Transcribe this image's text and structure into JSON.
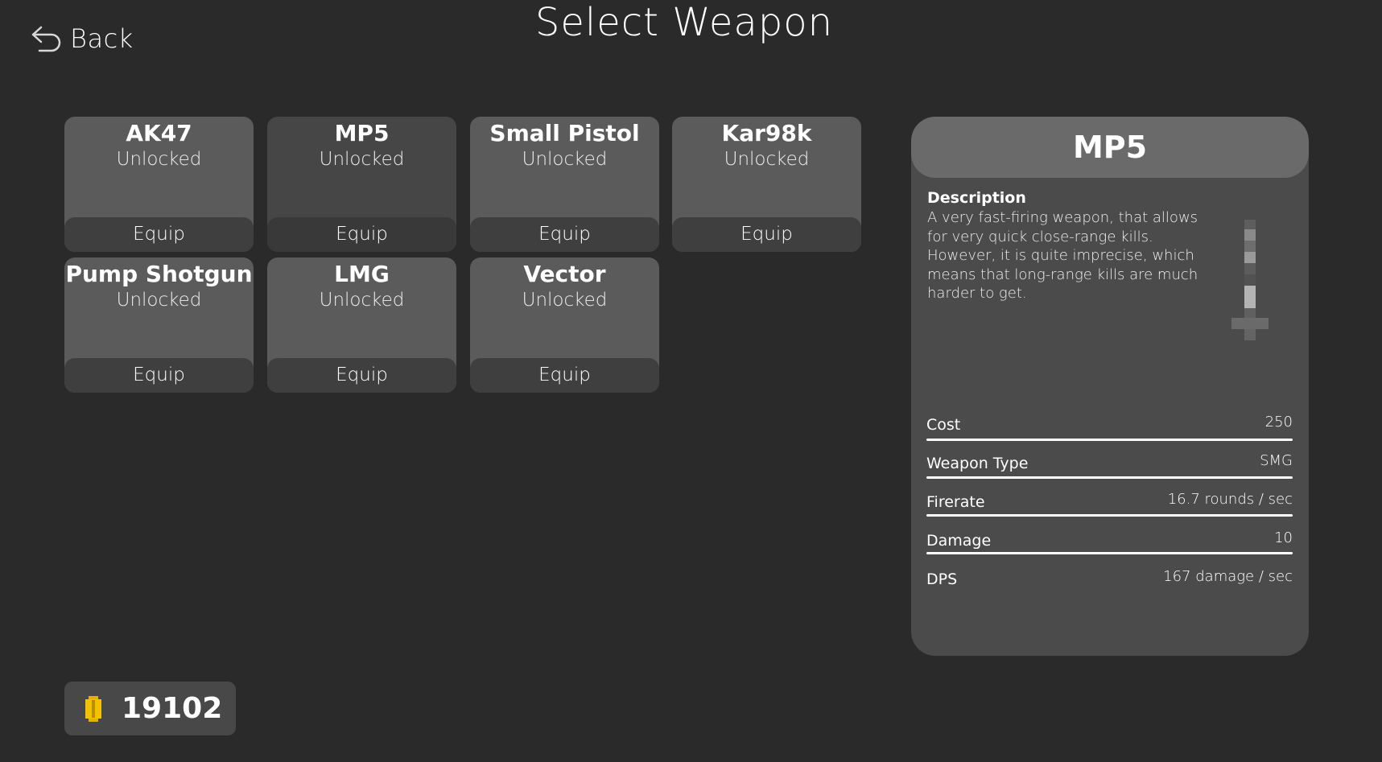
{
  "header": {
    "back_label": "Back",
    "title": "Select Weapon"
  },
  "weapons": [
    {
      "name": "AK47",
      "status": "Unlocked",
      "action": "Equip"
    },
    {
      "name": "MP5",
      "status": "Unlocked",
      "action": "Equip",
      "selected": true
    },
    {
      "name": "Small Pistol",
      "status": "Unlocked",
      "action": "Equip"
    },
    {
      "name": "Kar98k",
      "status": "Unlocked",
      "action": "Equip"
    },
    {
      "name": "Pump Shotgun",
      "status": "Unlocked",
      "action": "Equip"
    },
    {
      "name": "LMG",
      "status": "Unlocked",
      "action": "Equip"
    },
    {
      "name": "Vector",
      "status": "Unlocked",
      "action": "Equip"
    }
  ],
  "details": {
    "name": "MP5",
    "description_label": "Description",
    "description": "A very fast-firing weapon, that allows for very quick close-range kills. However, it is quite imprecise, which means that long-range kills are much harder to get.",
    "stats": [
      {
        "label": "Cost",
        "value": "250"
      },
      {
        "label": "Weapon Type",
        "value": "SMG"
      },
      {
        "label": "Firerate",
        "value": "16.7 rounds / sec"
      },
      {
        "label": "Damage",
        "value": "10"
      },
      {
        "label": "DPS",
        "value": "167 damage / sec"
      }
    ]
  },
  "currency": {
    "amount": "19102",
    "icon": "coin-icon",
    "color": "#f2c200"
  },
  "colors": {
    "background": "#2a2a2a",
    "card": "#5b5b5b",
    "card_selected": "#464646",
    "equip_bar": "#3f3f3f",
    "panel": "#4b4b4b",
    "panel_header": "#6a6a6a"
  }
}
